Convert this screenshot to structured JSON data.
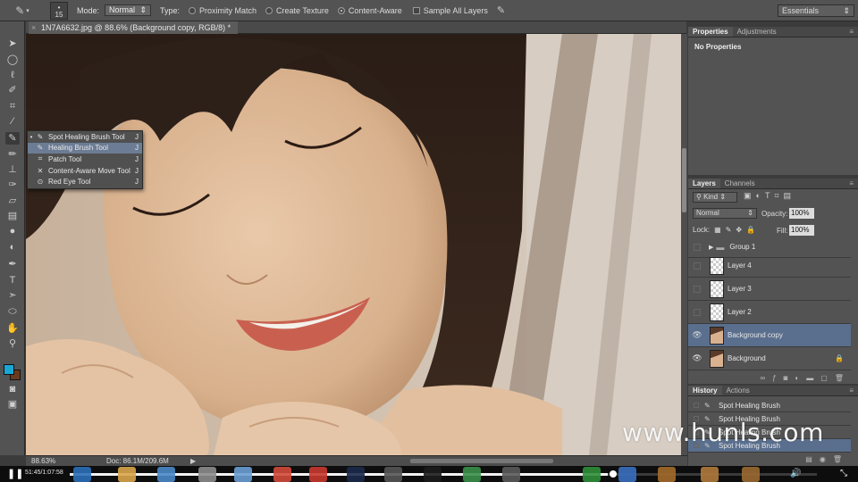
{
  "options_bar": {
    "brush_size": "15",
    "mode_label": "Mode:",
    "mode_value": "Normal",
    "type_label": "Type:",
    "type_options": [
      "Proximity Match",
      "Create Texture",
      "Content-Aware"
    ],
    "type_selected": "Content-Aware",
    "sample_all_layers": "Sample All Layers",
    "workspace": "Essentials"
  },
  "document": {
    "tab_title": "1N7A6632.jpg @ 88.6% (Background copy, RGB/8) *"
  },
  "tool_flyout": {
    "items": [
      {
        "label": "Spot Healing Brush Tool",
        "shortcut": "J",
        "current": true
      },
      {
        "label": "Healing Brush Tool",
        "shortcut": "J",
        "hovered": true
      },
      {
        "label": "Patch Tool",
        "shortcut": "J"
      },
      {
        "label": "Content-Aware Move Tool",
        "shortcut": "J"
      },
      {
        "label": "Red Eye Tool",
        "shortcut": "J"
      }
    ]
  },
  "status_bar": {
    "zoom": "88.63%",
    "doc_size": "Doc: 86.1M/209.6M"
  },
  "properties_panel": {
    "tabs": [
      "Properties",
      "Adjustments"
    ],
    "content": "No Properties"
  },
  "layers_panel": {
    "tabs": [
      "Layers",
      "Channels"
    ],
    "filter": "Kind",
    "blend_mode": "Normal",
    "opacity_label": "Opacity:",
    "opacity": "100%",
    "lock_label": "Lock:",
    "fill_label": "Fill:",
    "fill": "100%",
    "layers": [
      {
        "name": "Group 1",
        "kind": "group",
        "visible": false
      },
      {
        "name": "Layer 4",
        "kind": "transparent",
        "visible": false
      },
      {
        "name": "Layer 3",
        "kind": "transparent",
        "visible": false
      },
      {
        "name": "Layer 2",
        "kind": "transparent",
        "visible": false
      },
      {
        "name": "Background copy",
        "kind": "photo",
        "visible": true,
        "selected": true
      },
      {
        "name": "Background",
        "kind": "photo",
        "visible": true,
        "locked": true
      }
    ]
  },
  "history_panel": {
    "tabs": [
      "History",
      "Actions"
    ],
    "states": [
      "Spot Healing Brush",
      "Spot Healing Brush",
      "Spot Healing Brush",
      "Spot Healing Brush"
    ]
  },
  "watermark": "www.hunls.com",
  "video_player": {
    "time": "51:45/1:07:58",
    "progress": 0.72
  },
  "colors": {
    "foreground": "#1aa7d6",
    "background": "#6b3a1e",
    "selection": "#5a6f8e"
  }
}
